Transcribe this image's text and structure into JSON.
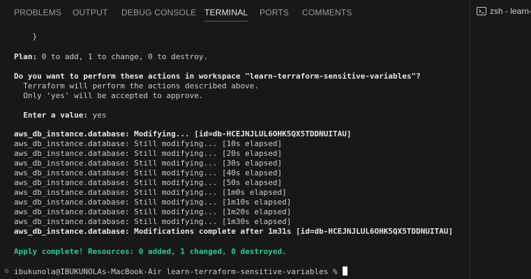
{
  "tabs": [
    {
      "label": "PROBLEMS"
    },
    {
      "label": "OUTPUT"
    },
    {
      "label": "DEBUG CONSOLE"
    },
    {
      "label": "TERMINAL"
    },
    {
      "label": "PORTS"
    },
    {
      "label": "COMMENTS"
    }
  ],
  "active_tab": "TERMINAL",
  "terminal_instance": {
    "label": "zsh - learn-",
    "icon": "terminal-icon"
  },
  "terminal": {
    "brace": "    }",
    "plan_label": "Plan:",
    "plan_rest": " 0 to add, 1 to change, 0 to destroy.",
    "question": "Do you want to perform these actions in workspace \"learn-terraform-sensitive-variables\"?",
    "info1": "  Terraform will perform the actions described above.",
    "info2": "  Only 'yes' will be accepted to approve.",
    "enter_label": "  Enter a value:",
    "enter_value": " yes",
    "modifying_line": "aws_db_instance.database: Modifying... [id=db-HCEJNJLUL6OHK5QX5TDDNUITAU]",
    "resource_prefix": "aws_db_instance.database:",
    "progress": [
      " Still modifying... [10s elapsed]",
      " Still modifying... [20s elapsed]",
      " Still modifying... [30s elapsed]",
      " Still modifying... [40s elapsed]",
      " Still modifying... [50s elapsed]",
      " Still modifying... [1m0s elapsed]",
      " Still modifying... [1m10s elapsed]",
      " Still modifying... [1m20s elapsed]",
      " Still modifying... [1m30s elapsed]"
    ],
    "complete_line": "aws_db_instance.database: Modifications complete after 1m31s [id=db-HCEJNJLUL6OHK5QX5TDDNUITAU]",
    "apply_line": "Apply complete! Resources: 0 added, 1 changed, 0 destroyed.",
    "prompt": "ibukunola@IBUKUNOLAs-MacBook-Air learn-terraform-sensitive-variables % "
  },
  "colors": {
    "background": "#181818",
    "active_tab_underline": "#0078d4",
    "success_green": "#23d18b"
  }
}
